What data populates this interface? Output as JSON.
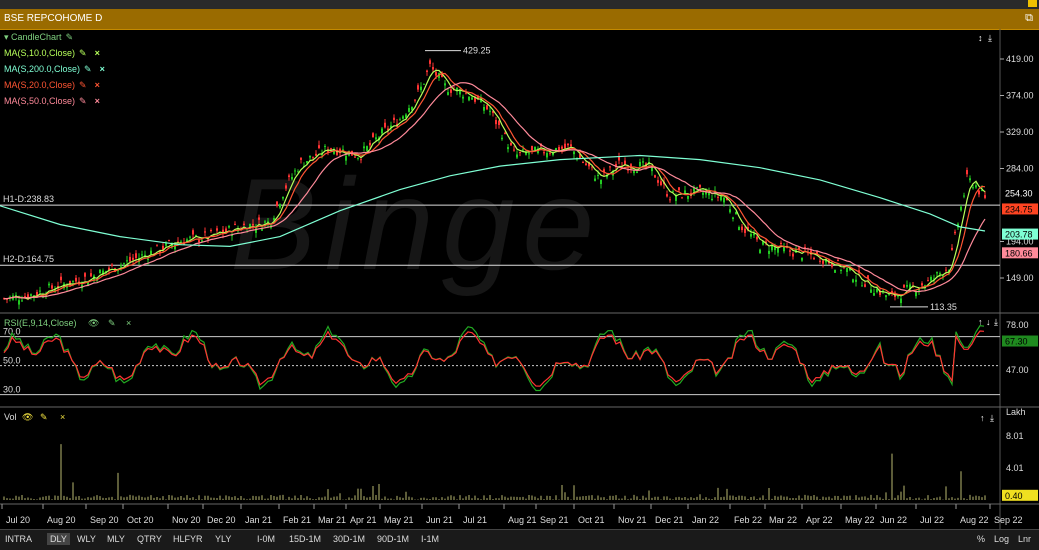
{
  "window": {
    "title": "BSE REPCOHOME D",
    "restore_icon": "restore-icon"
  },
  "watermark": "Binge",
  "main_pane": {
    "legend": {
      "candle": "CandleChart",
      "ma": [
        {
          "label": "MA(S,10.0,Close)",
          "color": "#b6ff5a"
        },
        {
          "label": "MA(S,200.0,Close)",
          "color": "#7fffd4"
        },
        {
          "label": "MA(S,20.0,Close)",
          "color": "#ff5533"
        },
        {
          "label": "MA(S,50.0,Close)",
          "color": "#ff8a9a"
        }
      ]
    },
    "price_axis": [
      "419.00",
      "374.00",
      "329.00",
      "284.00",
      "194.00",
      "149.00"
    ],
    "badges": [
      {
        "text": "254.30",
        "bg": "#000000",
        "fg": "#ffffff"
      },
      {
        "text": "234.75",
        "bg": "#ff4422",
        "fg": "#000000"
      },
      {
        "text": "203.78",
        "bg": "#7fffd4",
        "fg": "#000000"
      },
      {
        "text": "180.66",
        "bg": "#ff8a9a",
        "fg": "#000000"
      }
    ],
    "h1_label": "H1-D:238.83",
    "h2_label": "H2-D:164.75",
    "high_label": "429.25",
    "low_label": "113.35"
  },
  "rsi_pane": {
    "legend": "RSI(E,9,14,Close)",
    "levels": [
      "70.0",
      "50.0",
      "30.0"
    ],
    "axis": [
      "78.00",
      "47.00"
    ],
    "badge": "67.30"
  },
  "vol_pane": {
    "legend": "Vol",
    "unit": "Lakh",
    "axis": [
      "8.01",
      "4.01"
    ],
    "badge": "0.40"
  },
  "x_axis": [
    "Jul 20",
    "Aug 20",
    "Sep 20",
    "Oct 20",
    "Nov 20",
    "Dec 20",
    "Jan 21",
    "Feb 21",
    "Mar 21",
    "Apr 21",
    "May 21",
    "Jun 21",
    "Jul 21",
    "Aug 21",
    "Sep 21",
    "Oct 21",
    "Nov 21",
    "Dec 21",
    "Jan 22",
    "Feb 22",
    "Mar 22",
    "Apr 22",
    "May 22",
    "Jun 22",
    "Jul 22",
    "Aug 22",
    "Sep 22"
  ],
  "bottom_bar": {
    "periods": [
      "INTRA",
      "DLY",
      "WLY",
      "MLY",
      "QTRY",
      "HLFYR",
      "YLY"
    ],
    "active": "DLY",
    "ranges": [
      "I-0M",
      "15D-1M",
      "30D-1M",
      "90D-1M",
      "I-1M"
    ],
    "right": [
      "%",
      "Log",
      "Lnr"
    ]
  }
}
